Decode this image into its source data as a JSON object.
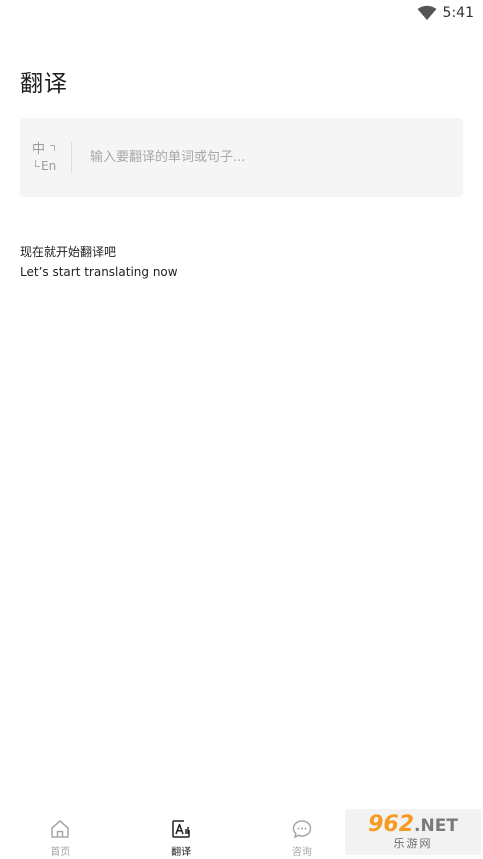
{
  "status_bar": {
    "time": "5:41",
    "wifi_icon": "wifi-icon"
  },
  "page": {
    "title": "翻译"
  },
  "search": {
    "lang_from": "中",
    "lang_to": "En",
    "placeholder": "输入要翻译的单词或句子..."
  },
  "intro": {
    "line_cn": "现在就开始翻译吧",
    "line_en": "Let’s start translating now"
  },
  "nav": {
    "items": [
      {
        "label": "首页",
        "icon": "home-icon",
        "active": false
      },
      {
        "label": "翻译",
        "icon": "translate-icon",
        "active": true
      },
      {
        "label": "咨询",
        "icon": "chat-icon",
        "active": false
      }
    ]
  },
  "watermark": {
    "brand": "962",
    "suffix": ".NET",
    "subtitle": "乐游网"
  },
  "colors": {
    "accent_orange": "#f59a23",
    "inactive_gray": "#a6a6a6",
    "input_bg": "#f5f5f5"
  }
}
